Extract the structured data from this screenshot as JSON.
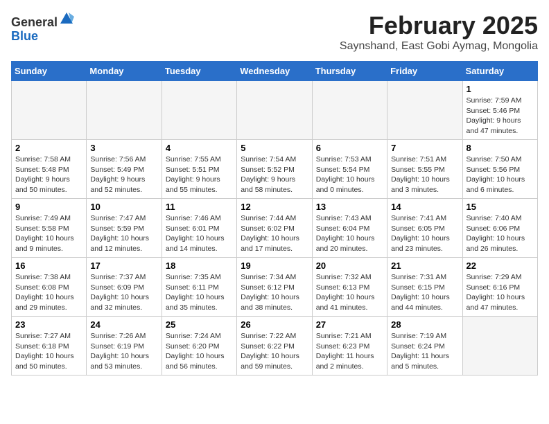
{
  "header": {
    "logo_general": "General",
    "logo_blue": "Blue",
    "month_title": "February 2025",
    "location": "Saynshand, East Gobi Aymag, Mongolia"
  },
  "weekdays": [
    "Sunday",
    "Monday",
    "Tuesday",
    "Wednesday",
    "Thursday",
    "Friday",
    "Saturday"
  ],
  "weeks": [
    [
      {
        "day": "",
        "info": ""
      },
      {
        "day": "",
        "info": ""
      },
      {
        "day": "",
        "info": ""
      },
      {
        "day": "",
        "info": ""
      },
      {
        "day": "",
        "info": ""
      },
      {
        "day": "",
        "info": ""
      },
      {
        "day": "1",
        "info": "Sunrise: 7:59 AM\nSunset: 5:46 PM\nDaylight: 9 hours and 47 minutes."
      }
    ],
    [
      {
        "day": "2",
        "info": "Sunrise: 7:58 AM\nSunset: 5:48 PM\nDaylight: 9 hours and 50 minutes."
      },
      {
        "day": "3",
        "info": "Sunrise: 7:56 AM\nSunset: 5:49 PM\nDaylight: 9 hours and 52 minutes."
      },
      {
        "day": "4",
        "info": "Sunrise: 7:55 AM\nSunset: 5:51 PM\nDaylight: 9 hours and 55 minutes."
      },
      {
        "day": "5",
        "info": "Sunrise: 7:54 AM\nSunset: 5:52 PM\nDaylight: 9 hours and 58 minutes."
      },
      {
        "day": "6",
        "info": "Sunrise: 7:53 AM\nSunset: 5:54 PM\nDaylight: 10 hours and 0 minutes."
      },
      {
        "day": "7",
        "info": "Sunrise: 7:51 AM\nSunset: 5:55 PM\nDaylight: 10 hours and 3 minutes."
      },
      {
        "day": "8",
        "info": "Sunrise: 7:50 AM\nSunset: 5:56 PM\nDaylight: 10 hours and 6 minutes."
      }
    ],
    [
      {
        "day": "9",
        "info": "Sunrise: 7:49 AM\nSunset: 5:58 PM\nDaylight: 10 hours and 9 minutes."
      },
      {
        "day": "10",
        "info": "Sunrise: 7:47 AM\nSunset: 5:59 PM\nDaylight: 10 hours and 12 minutes."
      },
      {
        "day": "11",
        "info": "Sunrise: 7:46 AM\nSunset: 6:01 PM\nDaylight: 10 hours and 14 minutes."
      },
      {
        "day": "12",
        "info": "Sunrise: 7:44 AM\nSunset: 6:02 PM\nDaylight: 10 hours and 17 minutes."
      },
      {
        "day": "13",
        "info": "Sunrise: 7:43 AM\nSunset: 6:04 PM\nDaylight: 10 hours and 20 minutes."
      },
      {
        "day": "14",
        "info": "Sunrise: 7:41 AM\nSunset: 6:05 PM\nDaylight: 10 hours and 23 minutes."
      },
      {
        "day": "15",
        "info": "Sunrise: 7:40 AM\nSunset: 6:06 PM\nDaylight: 10 hours and 26 minutes."
      }
    ],
    [
      {
        "day": "16",
        "info": "Sunrise: 7:38 AM\nSunset: 6:08 PM\nDaylight: 10 hours and 29 minutes."
      },
      {
        "day": "17",
        "info": "Sunrise: 7:37 AM\nSunset: 6:09 PM\nDaylight: 10 hours and 32 minutes."
      },
      {
        "day": "18",
        "info": "Sunrise: 7:35 AM\nSunset: 6:11 PM\nDaylight: 10 hours and 35 minutes."
      },
      {
        "day": "19",
        "info": "Sunrise: 7:34 AM\nSunset: 6:12 PM\nDaylight: 10 hours and 38 minutes."
      },
      {
        "day": "20",
        "info": "Sunrise: 7:32 AM\nSunset: 6:13 PM\nDaylight: 10 hours and 41 minutes."
      },
      {
        "day": "21",
        "info": "Sunrise: 7:31 AM\nSunset: 6:15 PM\nDaylight: 10 hours and 44 minutes."
      },
      {
        "day": "22",
        "info": "Sunrise: 7:29 AM\nSunset: 6:16 PM\nDaylight: 10 hours and 47 minutes."
      }
    ],
    [
      {
        "day": "23",
        "info": "Sunrise: 7:27 AM\nSunset: 6:18 PM\nDaylight: 10 hours and 50 minutes."
      },
      {
        "day": "24",
        "info": "Sunrise: 7:26 AM\nSunset: 6:19 PM\nDaylight: 10 hours and 53 minutes."
      },
      {
        "day": "25",
        "info": "Sunrise: 7:24 AM\nSunset: 6:20 PM\nDaylight: 10 hours and 56 minutes."
      },
      {
        "day": "26",
        "info": "Sunrise: 7:22 AM\nSunset: 6:22 PM\nDaylight: 10 hours and 59 minutes."
      },
      {
        "day": "27",
        "info": "Sunrise: 7:21 AM\nSunset: 6:23 PM\nDaylight: 11 hours and 2 minutes."
      },
      {
        "day": "28",
        "info": "Sunrise: 7:19 AM\nSunset: 6:24 PM\nDaylight: 11 hours and 5 minutes."
      },
      {
        "day": "",
        "info": ""
      }
    ]
  ]
}
